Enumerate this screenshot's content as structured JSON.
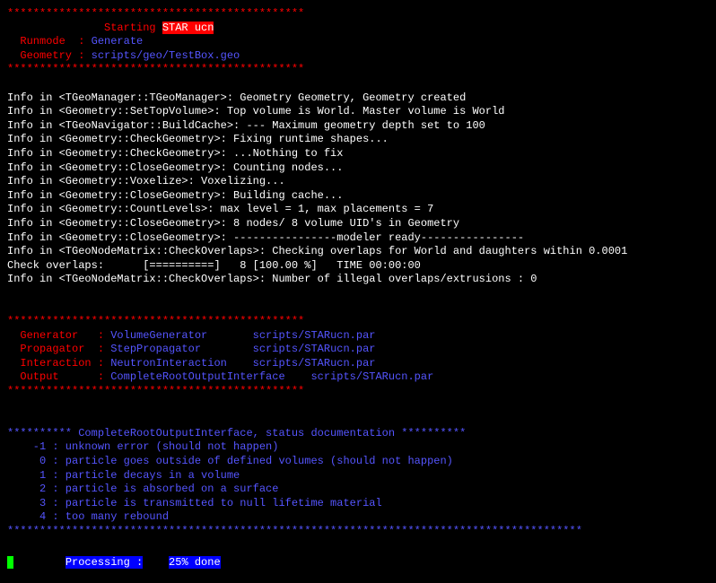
{
  "header": {
    "asterisks": "**********************************************",
    "starting": "               Starting ",
    "star_ucn": "STAR ucn",
    "runmode_label": "  Runmode  : ",
    "runmode_value": "Generate",
    "geometry_label": "  Geometry : ",
    "geometry_value": "scripts/geo/TestBox.geo"
  },
  "info_lines": [
    "Info in <TGeoManager::TGeoManager>: Geometry Geometry, Geometry created",
    "Info in <Geometry::SetTopVolume>: Top volume is World. Master volume is World",
    "Info in <TGeoNavigator::BuildCache>: --- Maximum geometry depth set to 100",
    "Info in <Geometry::CheckGeometry>: Fixing runtime shapes...",
    "Info in <Geometry::CheckGeometry>: ...Nothing to fix",
    "Info in <Geometry::CloseGeometry>: Counting nodes...",
    "Info in <Geometry::Voxelize>: Voxelizing...",
    "Info in <Geometry::CloseGeometry>: Building cache...",
    "Info in <Geometry::CountLevels>: max level = 1, max placements = 7",
    "Info in <Geometry::CloseGeometry>: 8 nodes/ 8 volume UID's in Geometry",
    "Info in <Geometry::CloseGeometry>: ----------------modeler ready----------------",
    "Info in <TGeoNodeMatrix::CheckOverlaps>: Checking overlaps for World and daughters within 0.0001",
    "Check overlaps:      [==========]   8 [100.00 %]   TIME 00:00:00",
    "Info in <TGeoNodeMatrix::CheckOverlaps>: Number of illegal overlaps/extrusions : 0"
  ],
  "config": {
    "generator_label": "  Generator   : ",
    "generator_value": "VolumeGenerator",
    "generator_path": "       scripts/STARucn.par",
    "propagator_label": "  Propagator  : ",
    "propagator_value": "StepPropagator",
    "propagator_path": "        scripts/STARucn.par",
    "interaction_label": "  Interaction : ",
    "interaction_value": "NeutronInteraction",
    "interaction_path": "    scripts/STARucn.par",
    "output_label": "  Output      : ",
    "output_value": "CompleteRootOutputInterface",
    "output_path": "    scripts/STARucn.par"
  },
  "status_doc": {
    "header": "********** CompleteRootOutputInterface, status documentation **********",
    "codes": [
      "    -1 : unknown error (should not happen)",
      "     0 : particle goes outside of defined volumes (should not happen)",
      "     1 : particle decays in a volume",
      "     2 : particle is absorbed on a surface",
      "     3 : particle is transmitted to null lifetime material",
      "     4 : too many rebound"
    ]
  },
  "long_asterisks": "*****************************************************************************************",
  "progress": {
    "cursor": " ",
    "processing": "Processing :",
    "padding": "    ",
    "percent": "25% done"
  }
}
